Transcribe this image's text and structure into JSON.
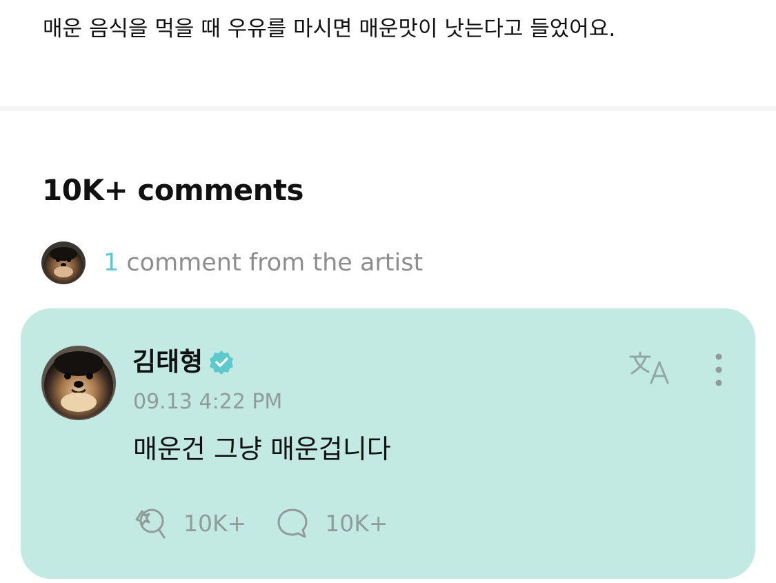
{
  "post": {
    "body": "매운 음식을 먹을 때 우유를 마시면 매운맛이 낫는다고 들었어요."
  },
  "comments": {
    "heading": "10K+ comments",
    "artist_count": "1",
    "artist_label": " comment from the artist"
  },
  "comment": {
    "author": "김태형",
    "verified": true,
    "timestamp": "09.13 4:22 PM",
    "text": "매운건 그냥 매운겁니다",
    "like_count": "10K+",
    "reply_count": "10K+"
  },
  "colors": {
    "accent": "#5cc9cc",
    "card_background": "#c2e9e2",
    "muted_text": "#8f9c99"
  },
  "icons": {
    "translate": "translate-icon",
    "more": "more-vertical-icon",
    "like": "like-icon",
    "reply": "reply-icon",
    "verified": "verified-badge-icon"
  }
}
